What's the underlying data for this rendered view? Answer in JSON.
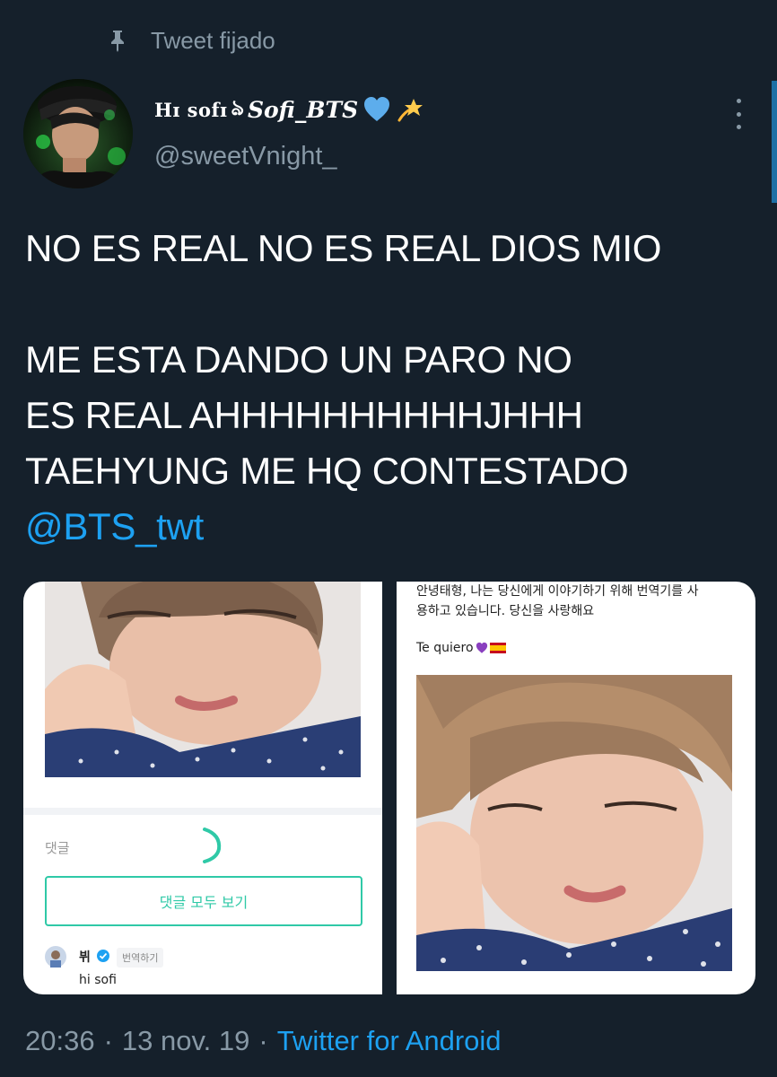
{
  "pinned": {
    "label": "Tweet fijado",
    "icon": "pin-icon"
  },
  "user": {
    "display_name_prefix": "Hɪ sofɪ",
    "display_name_swirl": "ঌ",
    "display_name_main": "Sofi_BTS",
    "display_name_emojis": [
      "blue-heart-icon",
      "dizzy-star-icon"
    ],
    "handle": "@sweetVnight_",
    "avatar": "avatar"
  },
  "more_icon": "more-vertical-icon",
  "tweet": {
    "line1": "NO ES REAL NO ES REAL DIOS MIO",
    "line2": "ME ESTA DANDO UN PARO NO",
    "line3": "ES REAL AHHHHHHHHHHJHHH",
    "line4": "TAEHYUNG ME HQ CONTESTADO",
    "mention": "@BTS_twt"
  },
  "media": {
    "left": {
      "comment_label": "댓글",
      "view_all_button": "댓글 모두 보기",
      "commenter_name": "뷔",
      "translate_button": "번역하기",
      "comment_text": "hi sofi"
    },
    "right": {
      "korean_line1": "안녕태형, 나는 당신에게 이야기하기 위해 번역기를 사",
      "korean_line2": "용하고 있습니다. 당신을 사랑해요",
      "spanish_text": "Te quiero"
    }
  },
  "footer": {
    "time": "20:36",
    "separator": "·",
    "date": "13 nov. 19",
    "via": "Twitter for Android"
  },
  "colors": {
    "background": "#15202b",
    "secondary_text": "#8899a6",
    "link": "#1da1f2",
    "accent_teal": "#2fc9a7"
  }
}
